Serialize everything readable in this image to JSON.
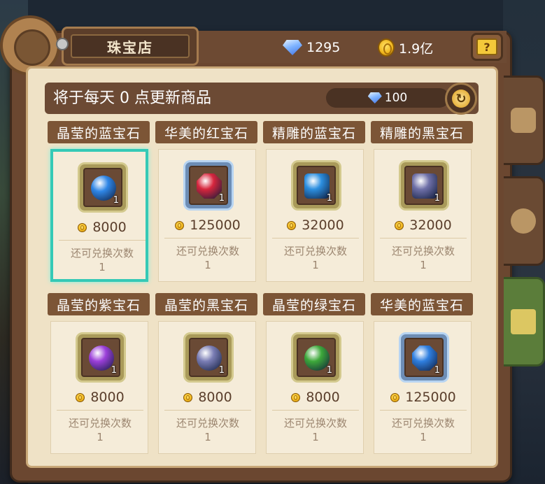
{
  "header": {
    "title": "珠宝店",
    "diamonds": "1295",
    "gold": "1.9亿",
    "help_symbol": "?"
  },
  "refresh": {
    "text": "将于每天 0 点更新商品",
    "cost": "100"
  },
  "items": [
    {
      "name": "晶莹的蓝宝石",
      "price": "8000",
      "qty": "1",
      "limit_label": "还可兑换次数",
      "limit": "1",
      "color": "#2f86e6",
      "shape": "round",
      "rarity": "common"
    },
    {
      "name": "华美的红宝石",
      "price": "125000",
      "qty": "1",
      "limit_label": "还可兑换次数",
      "limit": "1",
      "color": "#d7263d",
      "shape": "octa",
      "rarity": "rare"
    },
    {
      "name": "精雕的蓝宝石",
      "price": "32000",
      "qty": "1",
      "limit_label": "还可兑换次数",
      "limit": "1",
      "color": "#2c8fe0",
      "shape": "square",
      "rarity": "common"
    },
    {
      "name": "精雕的黑宝石",
      "price": "32000",
      "qty": "1",
      "limit_label": "还可兑换次数",
      "limit": "1",
      "color": "#6f70a8",
      "shape": "square",
      "rarity": "common"
    },
    {
      "name": "晶莹的紫宝石",
      "price": "8000",
      "qty": "1",
      "limit_label": "还可兑换次数",
      "limit": "1",
      "color": "#9b3fd9",
      "shape": "round",
      "rarity": "common"
    },
    {
      "name": "晶莹的黑宝石",
      "price": "8000",
      "qty": "1",
      "limit_label": "还可兑换次数",
      "limit": "1",
      "color": "#7a7db4",
      "shape": "round",
      "rarity": "common"
    },
    {
      "name": "晶莹的绿宝石",
      "price": "8000",
      "qty": "1",
      "limit_label": "还可兑换次数",
      "limit": "1",
      "color": "#3da83a",
      "shape": "round",
      "rarity": "common"
    },
    {
      "name": "华美的蓝宝石",
      "price": "125000",
      "qty": "1",
      "limit_label": "还可兑换次数",
      "limit": "1",
      "color": "#2f7fe0",
      "shape": "octa",
      "rarity": "rare"
    }
  ],
  "selected_index": 0,
  "side_tabs": [
    {
      "icon": "badge-icon",
      "active": false
    },
    {
      "icon": "compass-icon",
      "active": false
    },
    {
      "icon": "shop-icon",
      "active": true
    }
  ]
}
